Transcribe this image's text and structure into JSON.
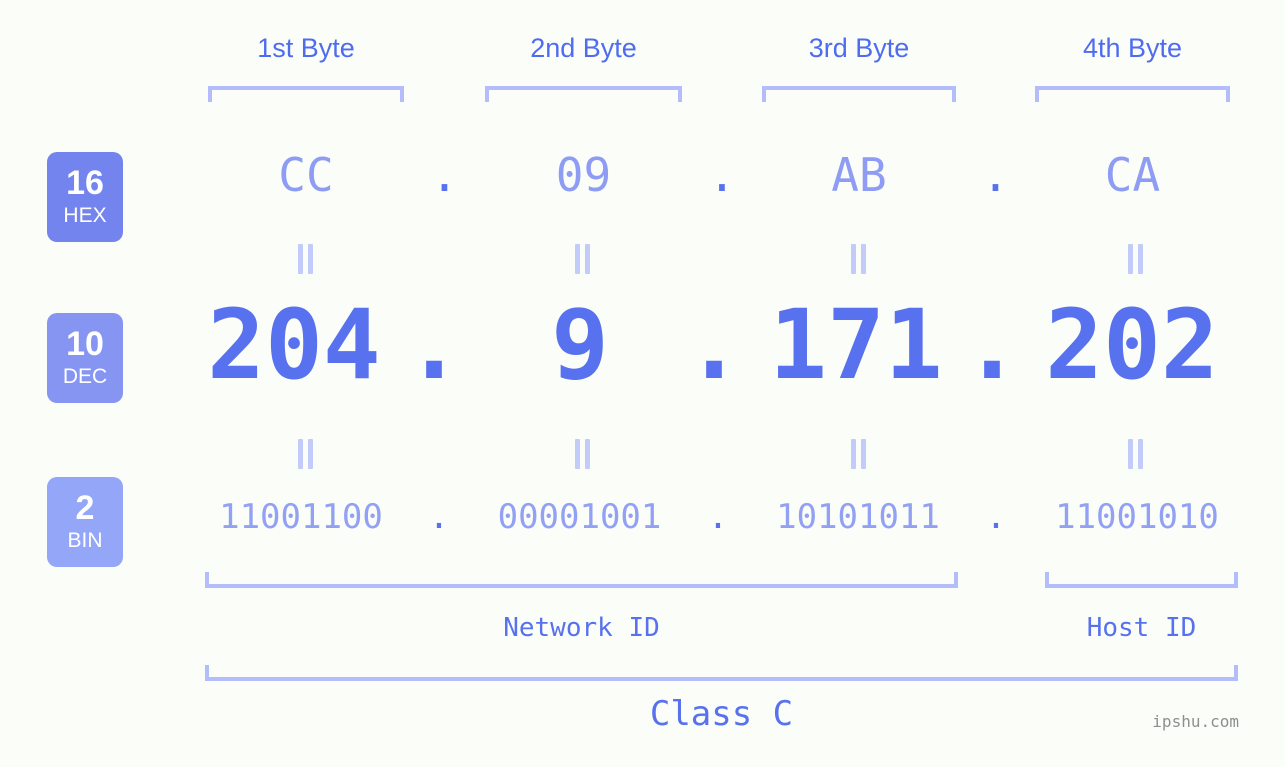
{
  "background": "#fbfdf8",
  "colors": {
    "accent_strong": "#5871ee",
    "accent_mid": "#8e9cf3",
    "accent_light": "#b3bdfb",
    "badge_hex": "#7384ee",
    "badge_dec": "#8795f2",
    "badge_bin": "#94a6f7",
    "watermark": "#8f8f8f"
  },
  "byte_headers": [
    {
      "label": "1st Byte"
    },
    {
      "label": "2nd Byte"
    },
    {
      "label": "3rd Byte"
    },
    {
      "label": "4th Byte"
    }
  ],
  "bases": [
    {
      "number": "16",
      "abbr": "HEX"
    },
    {
      "number": "10",
      "abbr": "DEC"
    },
    {
      "number": "2",
      "abbr": "BIN"
    }
  ],
  "rows": {
    "hex": {
      "base_number": "16",
      "base_abbr": "HEX",
      "values": [
        "CC",
        "09",
        "AB",
        "CA"
      ],
      "separator": "."
    },
    "dec": {
      "base_number": "10",
      "base_abbr": "DEC",
      "values": [
        "204",
        "9",
        "171",
        "202"
      ],
      "separator": "."
    },
    "bin": {
      "base_number": "2",
      "base_abbr": "BIN",
      "values": [
        "11001100",
        "00001001",
        "10101011",
        "11001010"
      ],
      "separator": "."
    }
  },
  "equals_marker": "=",
  "sections": {
    "network_id": "Network ID",
    "host_id": "Host ID",
    "class": "Class C"
  },
  "watermark": "ipshu.com"
}
